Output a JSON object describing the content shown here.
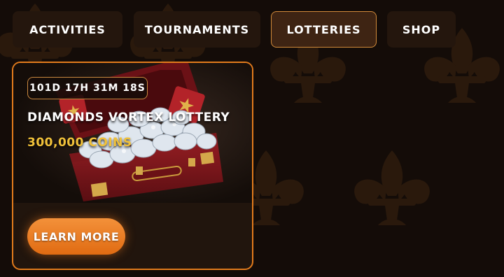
{
  "colors": {
    "background": "#140c08",
    "tab_bg": "#24160d",
    "tab_active_bg": "#3e2413",
    "accent_orange": "#e27b1c",
    "prize_gold": "#f0c13a"
  },
  "tabs": [
    {
      "label": "ACTIVITIES",
      "active": false
    },
    {
      "label": "TOURNAMENTS",
      "active": false
    },
    {
      "label": "LOTTERIES",
      "active": true
    },
    {
      "label": "SHOP",
      "active": false
    }
  ],
  "lottery": {
    "countdown": "101D 17H 31M 18S",
    "title": "DIAMONDS VORTEX LOTTERY",
    "prize": "300,000 COINS",
    "cta_label": "LEARN MORE",
    "image_icon": "diamond-briefcase-image"
  },
  "background_icon": "fleur-de-lis-icon"
}
